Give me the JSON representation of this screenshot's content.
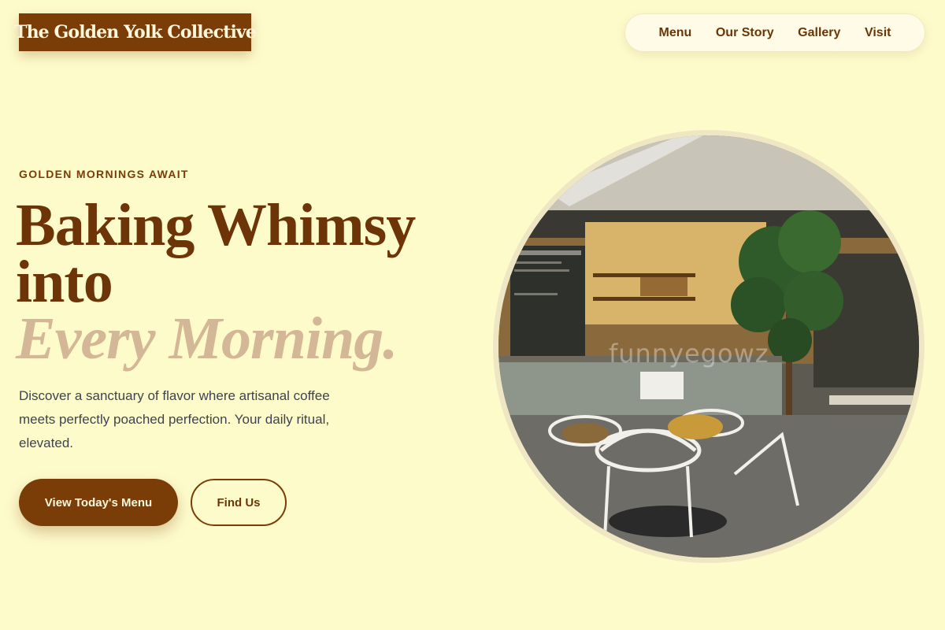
{
  "brand": {
    "name": "The Golden Yolk Collective"
  },
  "nav": {
    "items": [
      {
        "label": "Menu"
      },
      {
        "label": "Our Story"
      },
      {
        "label": "Gallery"
      },
      {
        "label": "Visit"
      }
    ]
  },
  "hero": {
    "eyebrow": "GOLDEN MORNINGS AWAIT",
    "headline_line1": "Baking Whimsy",
    "headline_line2": "into",
    "headline_accent": "Every Morning.",
    "description": "Discover a sanctuary of flavor where artisanal coffee meets perfectly poached perfection. Your daily ritual, elevated.",
    "primary_cta": "View Today's Menu",
    "secondary_cta": "Find Us",
    "image_watermark": "funnyegowz"
  },
  "colors": {
    "background": "#fefbcb",
    "brand_brown": "#7a3d07",
    "accent_tan": "#d3b796",
    "nav_background": "#fffbe6"
  }
}
